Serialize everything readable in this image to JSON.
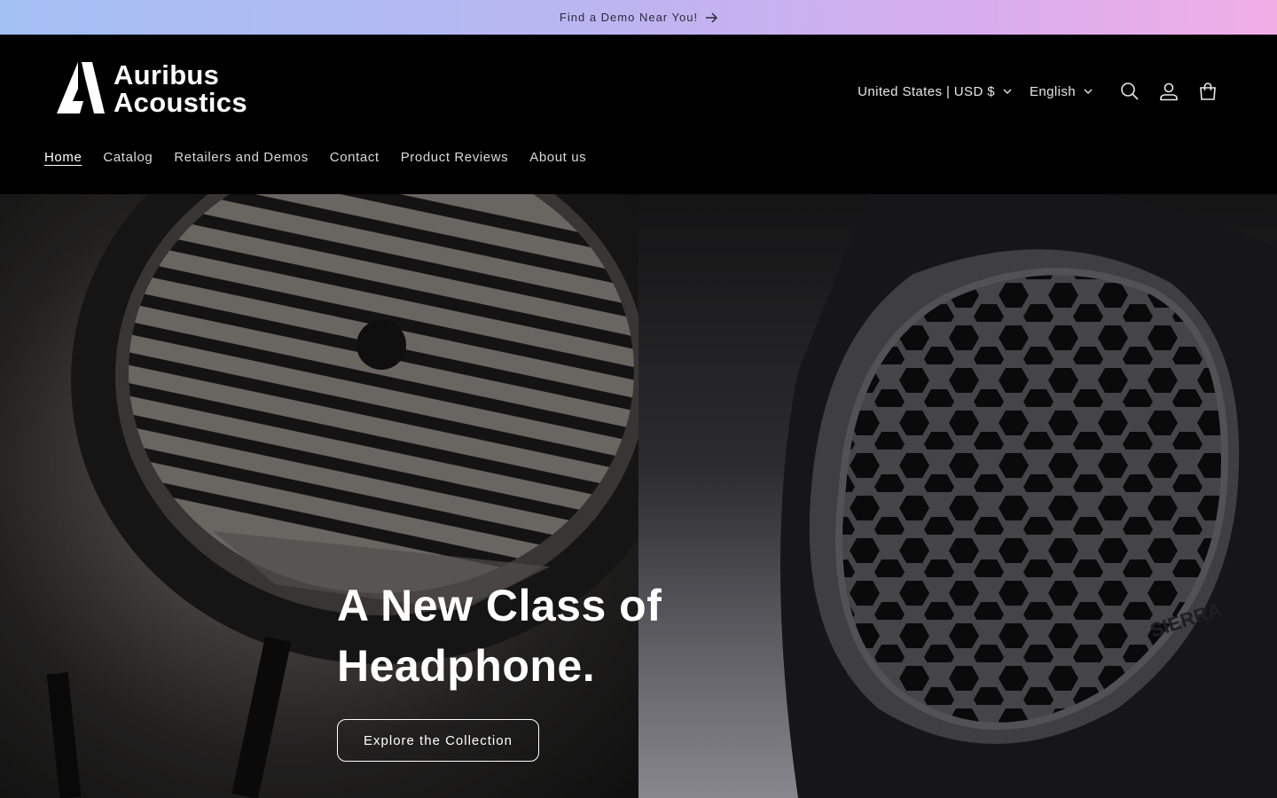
{
  "announcement": {
    "text": "Find a Demo Near You!",
    "icon": "arrow-right-icon"
  },
  "brand": {
    "line1": "Auribus",
    "line2": "Acoustics"
  },
  "header": {
    "country_selector": "United States | USD $",
    "language_selector": "English",
    "icons": [
      "search-icon",
      "account-icon",
      "cart-icon"
    ]
  },
  "nav": {
    "items": [
      {
        "label": "Home",
        "active": true
      },
      {
        "label": "Catalog"
      },
      {
        "label": "Retailers and Demos"
      },
      {
        "label": "Contact"
      },
      {
        "label": "Product Reviews"
      },
      {
        "label": "About us"
      }
    ]
  },
  "hero": {
    "title_line1": "A New Class of",
    "title_line2": "Headphone.",
    "button_label": "Explore the Collection",
    "product_engraving": "SIERRA"
  },
  "colors": {
    "announcement_gradient": [
      "#a3c0f3",
      "#f1aee6"
    ],
    "header_bg": "#000000",
    "text": "#ffffff"
  }
}
